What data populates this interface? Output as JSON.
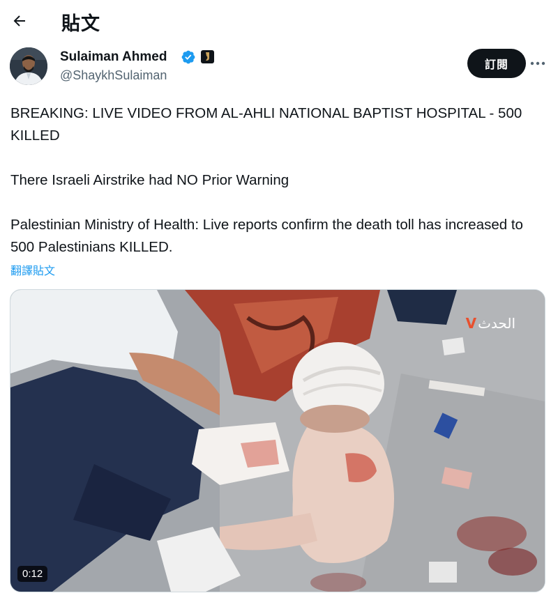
{
  "header": {
    "title": "貼文",
    "back_icon": "arrow-left-icon"
  },
  "author": {
    "display_name": "Sulaiman Ahmed",
    "handle": "@ShaykhSulaiman",
    "verified_icon": "verified-badge-icon",
    "affiliation_icon": "affiliate-badge-icon",
    "subscribe_label": "訂閱",
    "more_icon": "more-options-icon"
  },
  "tweet": {
    "paragraphs": [
      "BREAKING: LIVE VIDEO FROM AL-AHLI NATIONAL BAPTIST HOSPITAL - 500 KILLED",
      "There Israeli Airstrike had NO Prior Warning",
      "Palestinian Ministry of Health: Live reports confirm the death toll has increased to 500 Palestinians KILLED."
    ],
    "translate_label": "翻譯貼文"
  },
  "media": {
    "type": "video",
    "duration": "0:12",
    "watermark_text": "الحدث",
    "watermark_mark": "V"
  },
  "colors": {
    "text": "#0f1419",
    "secondary": "#536471",
    "link": "#1d9bf0",
    "verified": "#1d9bf0",
    "button_bg": "#0f1419"
  }
}
